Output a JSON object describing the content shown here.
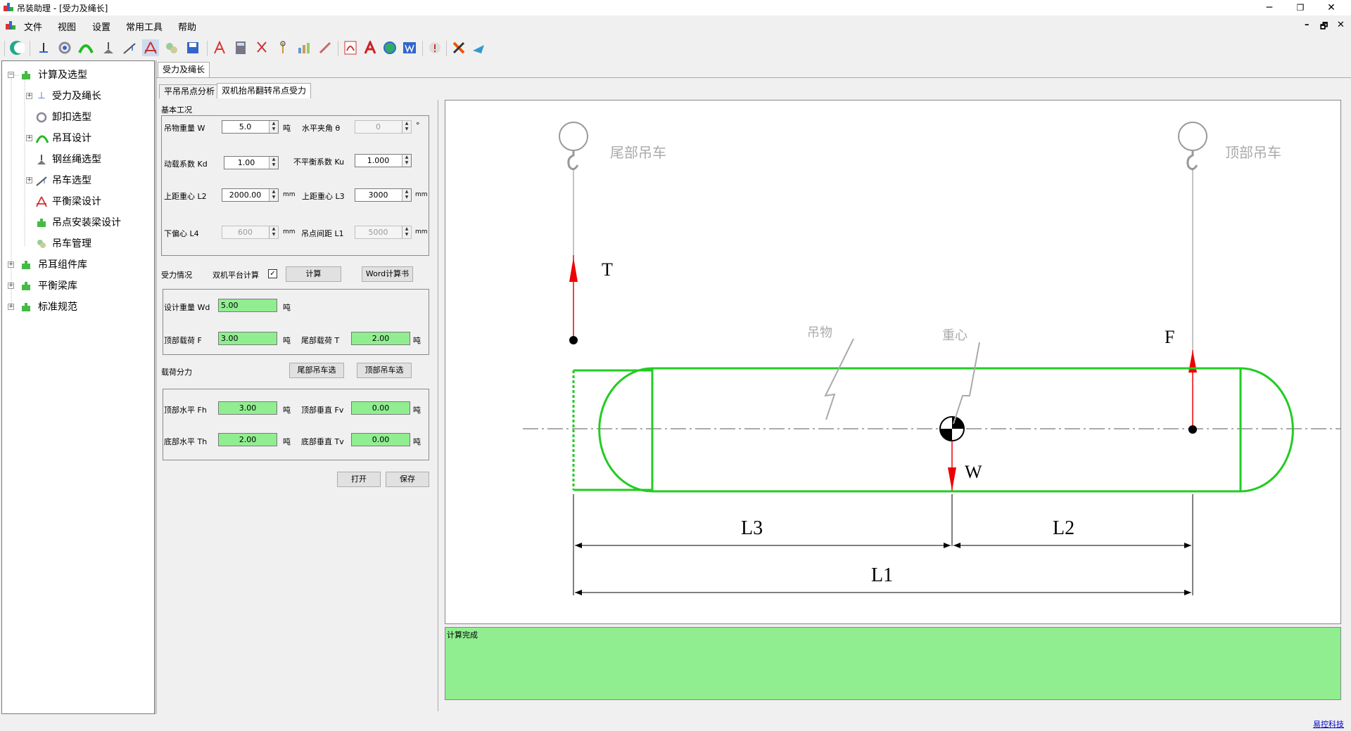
{
  "window": {
    "title": "吊装助理 - [受力及绳长]",
    "minimize": "─",
    "maximize": "❐",
    "close": "✕"
  },
  "menu": {
    "items": [
      "文件",
      "视图",
      "设置",
      "常用工具",
      "帮助"
    ],
    "mdi_min": "–",
    "mdi_restore": "🗗",
    "mdi_close": "✕"
  },
  "toolbar": {
    "icons": [
      "moon-icon",
      "anchor-icon",
      "shackle-icon",
      "lug-icon",
      "rope-icon",
      "crane-icon",
      "beam-icon",
      "assembly-icon",
      "save-icon",
      "text-icon",
      "calc-icon",
      "scissors-icon",
      "tools-icon",
      "chart-icon",
      "pen-icon",
      "pdf-icon",
      "font-icon",
      "globe-icon",
      "word-icon",
      "info-icon",
      "exit-icon",
      "export-icon"
    ]
  },
  "tree": {
    "root1": "计算及选型",
    "children": [
      "受力及绳长",
      "卸扣选型",
      "吊耳设计",
      "钢丝绳选型",
      "吊车选型",
      "平衡梁设计",
      "吊点安装梁设计",
      "吊车管理"
    ],
    "root2": "吊耳组件库",
    "root3": "平衡梁库",
    "root4": "标准规范"
  },
  "doc_tab": "受力及绳长",
  "sub_tabs": [
    "平吊吊点分析",
    "双机抬吊翻转吊点受力"
  ],
  "basic": {
    "header": "基本工况",
    "weight_label": "吊物重量 W",
    "weight": "5.0",
    "unit_t": "吨",
    "angle_label": "水平夹角 θ",
    "angle": "0",
    "unit_deg": "°",
    "kd_label": "动载系数 Kd",
    "kd": "1.00",
    "ku_label": "不平衡系数 Ku",
    "ku": "1.000",
    "l2_label": "上距重心 L2",
    "l2": "2000.00",
    "unit_mm": "mm",
    "l3_label": "上距重心 L3",
    "l3": "3000",
    "l4_label": "下偏心 L4",
    "l4": "600",
    "l1_label": "吊点间距 L1",
    "l1": "5000"
  },
  "force": {
    "header": "受力情况",
    "dual_label": "双机平台计算",
    "dual_checked": "✓",
    "calc_btn": "计算",
    "word_btn": "Word计算书",
    "wd_label": "设计重量 Wd",
    "wd": "5.00",
    "f_label": "顶部载荷 F",
    "f": "3.00",
    "t_label": "尾部载荷 T",
    "t": "2.00"
  },
  "split": {
    "header": "载荷分力",
    "tail_btn": "尾部吊车选",
    "top_btn": "顶部吊车选",
    "fh_label": "顶部水平 Fh",
    "fh": "3.00",
    "fv_label": "顶部垂直 Fv",
    "fv": "0.00",
    "th_label": "底部水平 Th",
    "th": "2.00",
    "tv_label": "底部垂直 Tv",
    "tv": "0.00",
    "open_btn": "打开",
    "save_btn": "保存"
  },
  "diagram": {
    "tail_crane": "尾部吊车",
    "top_crane": "顶部吊车",
    "T": "T",
    "F": "F",
    "W": "W",
    "object": "吊物",
    "cog": "重心",
    "L1": "L1",
    "L2": "L2",
    "L3": "L3"
  },
  "message": "计算完成",
  "status": {
    "link": "易控科技"
  }
}
